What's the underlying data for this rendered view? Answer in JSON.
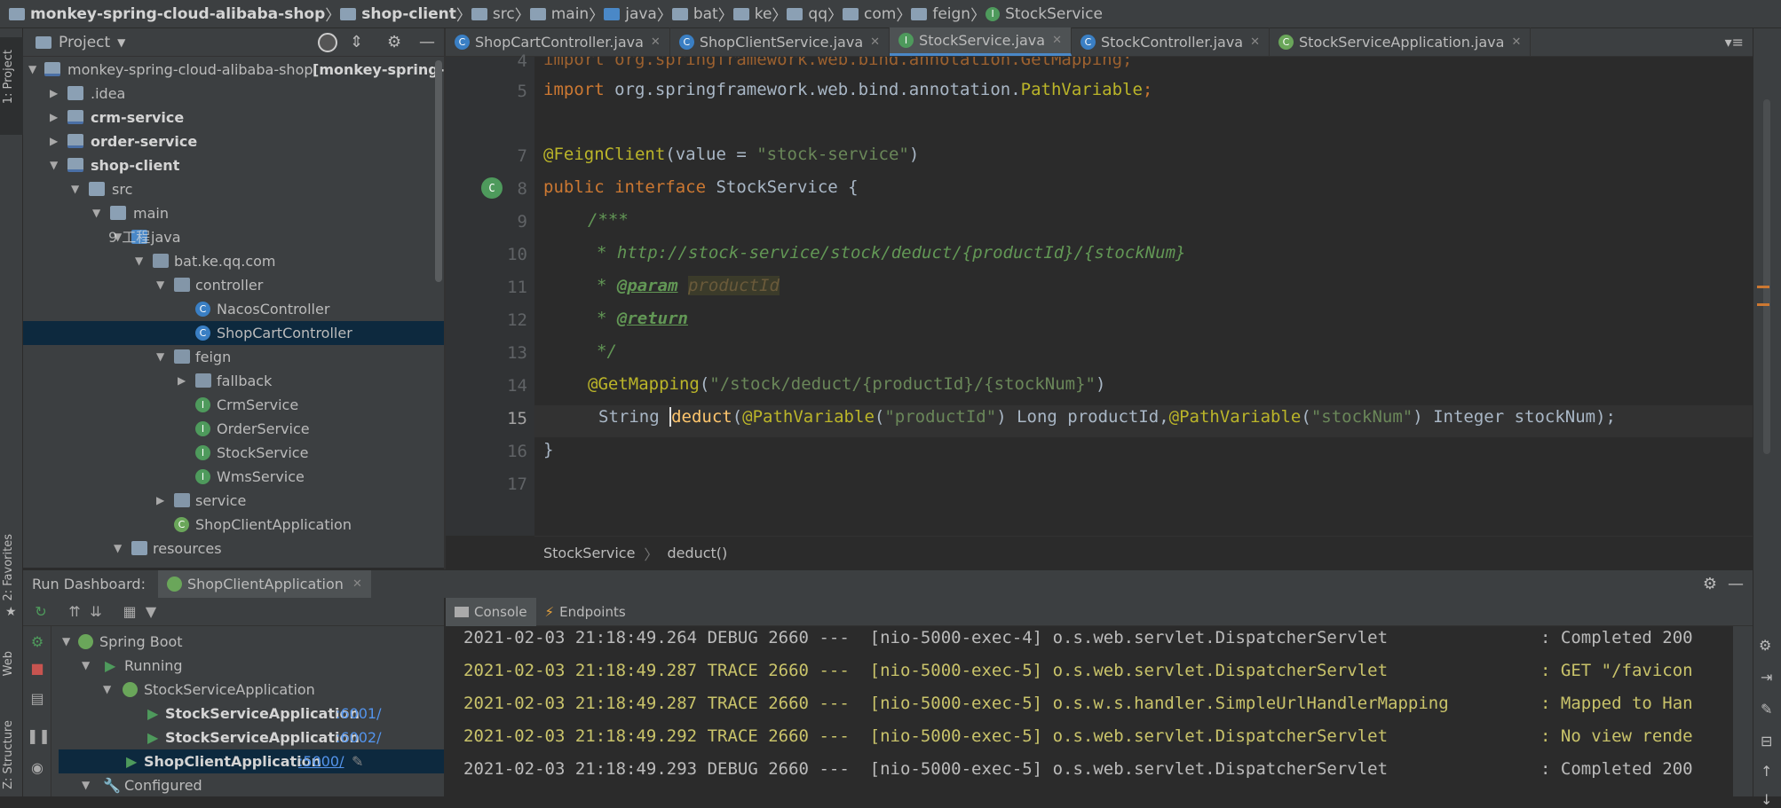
{
  "breadcrumb": {
    "items": [
      "monkey-spring-cloud-alibaba-shop",
      "shop-client",
      "src",
      "main",
      "java",
      "bat",
      "ke",
      "qq",
      "com",
      "feign",
      "StockService"
    ]
  },
  "left_strip": {
    "project_tab": "1: Project",
    "favorites_tab": "2: Favorites",
    "web_tab": "Web",
    "structure_tab": "Z: Structure"
  },
  "project_panel": {
    "title": "Project",
    "dropdown_icon": "chevron-down-icon"
  },
  "tree": {
    "root_label": "monkey-spring-cloud-alibaba-shop",
    "root_suffix": "[monkey-spring-cl",
    "idea": ".idea",
    "crm": "crm-service",
    "order": "order-service",
    "shop": "shop-client",
    "src": "src",
    "main": "main",
    "java": "java",
    "java_overlay": "9 工程",
    "pkg": "bat.ke.qq.com",
    "controller": "controller",
    "nacos": "NacosController",
    "shopcart": "ShopCartController",
    "feign": "feign",
    "fallback": "fallback",
    "crmsvc": "CrmService",
    "ordersvc": "OrderService",
    "stocksvc": "StockService",
    "wmssvc": "WmsService",
    "service": "service",
    "app": "ShopClientApplication",
    "resources": "resources"
  },
  "tabs": [
    "ShopCartController.java",
    "ShopClientService.java",
    "StockService.java",
    "StockController.java",
    "StockServiceApplication.java"
  ],
  "active_tab": "StockService.java",
  "editor": {
    "line_numbers": [
      "4",
      "5",
      "",
      "7",
      "8",
      "9",
      "10",
      "11",
      "12",
      "13",
      "14",
      "15",
      "16",
      "17"
    ],
    "l4": "import org.springframework.web.bind.annotation.GetMapping;",
    "l5_kw": "import",
    "l5_rest": " org.springframework.web.bind.annotation.",
    "l5_cls": "PathVariable",
    "l5_end": ";",
    "l7_ann": "@FeignClient",
    "l7_a": "(value = ",
    "l7_str": "\"stock-service\"",
    "l7_b": ")",
    "l8_kw": "public interface",
    "l8_rest": " StockService {",
    "l9": "/***",
    "l10": "* http://stock-service/stock/deduct/{productId}/{stockNum}",
    "l11_star": "* ",
    "l11_tag": "@param",
    "l11_sp": " ",
    "l11_val": "productId",
    "l12_star": "* ",
    "l12_tag": "@return",
    "l13": "*/",
    "l14_ann": "@GetMapping",
    "l14_a": "(",
    "l14_str": "\"/stock/deduct/{productId}/{stockNum}\"",
    "l14_b": ")",
    "l15_a": "String ",
    "l15_m": "deduct",
    "l15_b": "(",
    "l15_ann1": "@PathVariable",
    "l15_c": "(",
    "l15_s1": "\"productId\"",
    "l15_d": ") Long productId,",
    "l15_ann2": "@PathVariable",
    "l15_e": "(",
    "l15_s2": "\"stockNum\"",
    "l15_f": ") Integer stockNum);",
    "l16": "}"
  },
  "editor_breadcrumb": [
    "StockService",
    "deduct()"
  ],
  "run_dashboard": {
    "title": "Run Dashboard:",
    "app_tab": "ShopClientApplication"
  },
  "run_tree": {
    "spring_boot": "Spring Boot",
    "running": "Running",
    "stock_app": "StockServiceApplication",
    "inst1": "StockServiceApplication",
    "port1": ":6001/",
    "inst2": "StockServiceApplication",
    "port2": ":6002/",
    "shop_app": "ShopClientApplication",
    "port3": ":5000/",
    "configured": "Configured"
  },
  "console_tabs": [
    "Console",
    "Endpoints"
  ],
  "log": [
    {
      "ts": "2021-02-03 21:18:49.264",
      "level": "DEBUG",
      "pid": "2660",
      "thread": "---  [nio-5000-exec-4]",
      "logger": "o.s.web.servlet.DispatcherServlet",
      "msg": ": Completed 200"
    },
    {
      "ts": "2021-02-03 21:18:49.287",
      "level": "TRACE",
      "pid": "2660",
      "thread": "---  [nio-5000-exec-5]",
      "logger": "o.s.web.servlet.DispatcherServlet",
      "msg": ": GET \"/favicon"
    },
    {
      "ts": "2021-02-03 21:18:49.287",
      "level": "TRACE",
      "pid": "2660",
      "thread": "---  [nio-5000-exec-5]",
      "logger": "o.s.w.s.handler.SimpleUrlHandlerMapping",
      "msg": ": Mapped to Han"
    },
    {
      "ts": "2021-02-03 21:18:49.292",
      "level": "TRACE",
      "pid": "2660",
      "thread": "---  [nio-5000-exec-5]",
      "logger": "o.s.web.servlet.DispatcherServlet",
      "msg": ": No view rende"
    },
    {
      "ts": "2021-02-03 21:18:49.293",
      "level": "DEBUG",
      "pid": "2660",
      "thread": "---  [nio-5000-exec-5]",
      "logger": "o.s.web.servlet.DispatcherServlet",
      "msg": ": Completed 200"
    }
  ],
  "colors": {
    "bg": "#2b2b2b",
    "panel": "#3c3f41",
    "selection": "#0d293e",
    "keyword": "#cc7832",
    "string": "#6a8759",
    "annotation": "#bbb529",
    "trace": "#c9c36a"
  }
}
